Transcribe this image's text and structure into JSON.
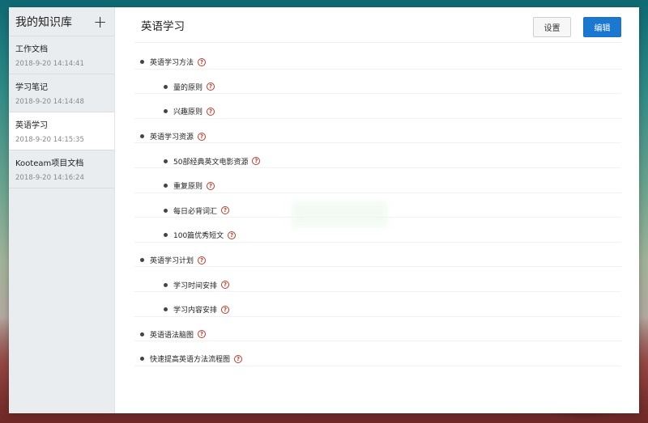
{
  "sidebar": {
    "title": "我的知识库",
    "add_label": "+",
    "items": [
      {
        "name": "工作文档",
        "time": "2018-9-20 14:14:41"
      },
      {
        "name": "学习笔记",
        "time": "2018-9-20 14:14:48"
      },
      {
        "name": "英语学习",
        "time": "2018-9-20 14:15:35"
      },
      {
        "name": "Kooteam项目文档",
        "time": "2018-9-20 14:16:24"
      }
    ]
  },
  "main": {
    "title": "英语学习",
    "settings_label": "设置",
    "edit_label": "编辑",
    "help_glyph": "?",
    "tree": [
      {
        "label": "英语学习方法",
        "children": [
          {
            "label": "量的原则"
          },
          {
            "label": "兴趣原则"
          }
        ]
      },
      {
        "label": "英语学习资源",
        "children": [
          {
            "label": "50部经典英文电影资源"
          },
          {
            "label": "重复原则"
          },
          {
            "label": "每日必背词汇"
          },
          {
            "label": "100篇优秀短文"
          }
        ]
      },
      {
        "label": "英语学习计划",
        "children": [
          {
            "label": "学习时间安排"
          },
          {
            "label": "学习内容安排"
          }
        ]
      },
      {
        "label": "英语语法脑图",
        "children": []
      },
      {
        "label": "快速提高英语方法流程图",
        "children": []
      }
    ]
  },
  "colors": {
    "accent": "#1a78d0",
    "help_icon": "#c0392b"
  }
}
